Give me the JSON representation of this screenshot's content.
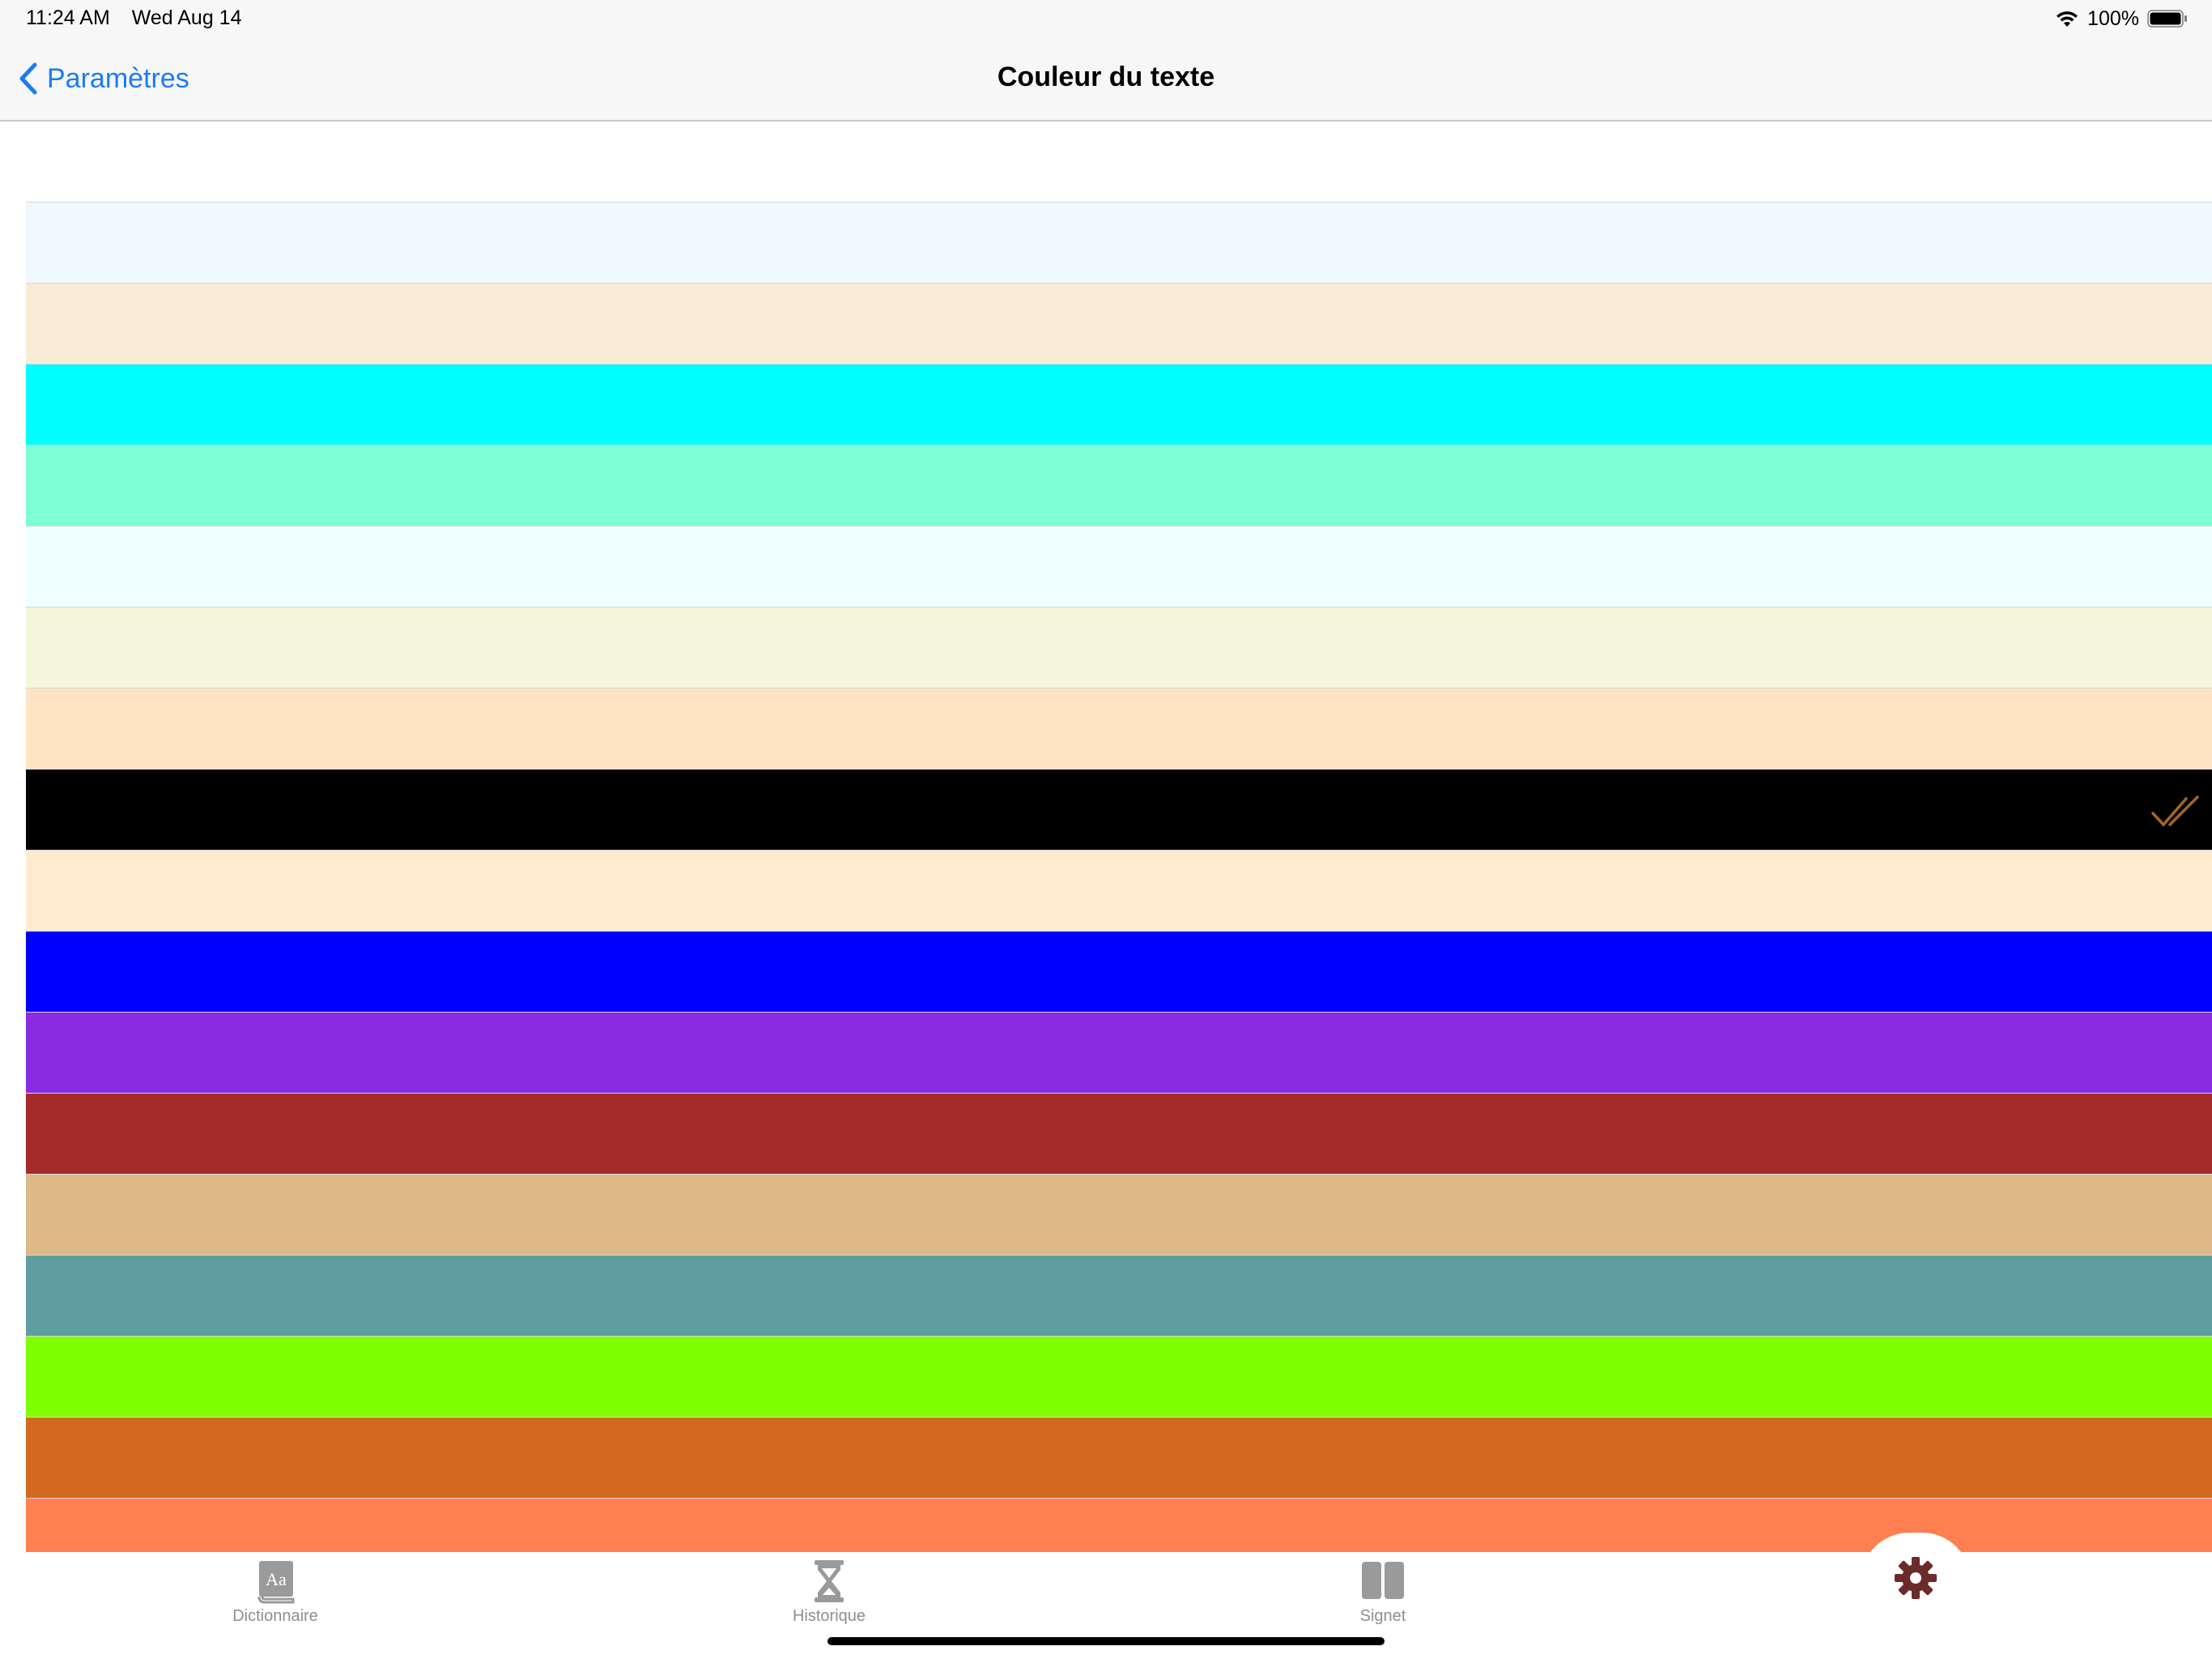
{
  "status_bar": {
    "time": "11:24 AM",
    "date": "Wed Aug 14",
    "battery": "100%"
  },
  "nav": {
    "back_label": "Paramètres",
    "title": "Couleur du texte"
  },
  "colors": [
    {
      "hex": "#ffffff",
      "selected": false
    },
    {
      "hex": "#f0f8ff",
      "selected": false
    },
    {
      "hex": "#faebd7",
      "selected": false
    },
    {
      "hex": "#00ffff",
      "selected": false
    },
    {
      "hex": "#7fffd4",
      "selected": false
    },
    {
      "hex": "#f0ffff",
      "selected": false
    },
    {
      "hex": "#f5f5dc",
      "selected": false
    },
    {
      "hex": "#ffe4c4",
      "selected": false
    },
    {
      "hex": "#000000",
      "selected": true
    },
    {
      "hex": "#ffebcd",
      "selected": false
    },
    {
      "hex": "#0000ff",
      "selected": false
    },
    {
      "hex": "#8a2be2",
      "selected": false
    },
    {
      "hex": "#a52a2a",
      "selected": false
    },
    {
      "hex": "#deb887",
      "selected": false
    },
    {
      "hex": "#5f9ea0",
      "selected": false
    },
    {
      "hex": "#7fff00",
      "selected": false
    },
    {
      "hex": "#d2691e",
      "selected": false
    },
    {
      "hex": "#ff7f50",
      "selected": false
    }
  ],
  "checkmark_color": "#a0672a",
  "accent_color": "#1a7cf5",
  "tabs": [
    {
      "label": "Dictionnaire",
      "icon": "dictionary-book-icon"
    },
    {
      "label": "Historique",
      "icon": "hourglass-icon"
    },
    {
      "label": "Signet",
      "icon": "open-book-icon"
    },
    {
      "label": "",
      "icon": "gear-icon",
      "active": true
    }
  ],
  "tab_active_color": "#6b2b2b",
  "tab_inactive_color": "#9a9a9a"
}
